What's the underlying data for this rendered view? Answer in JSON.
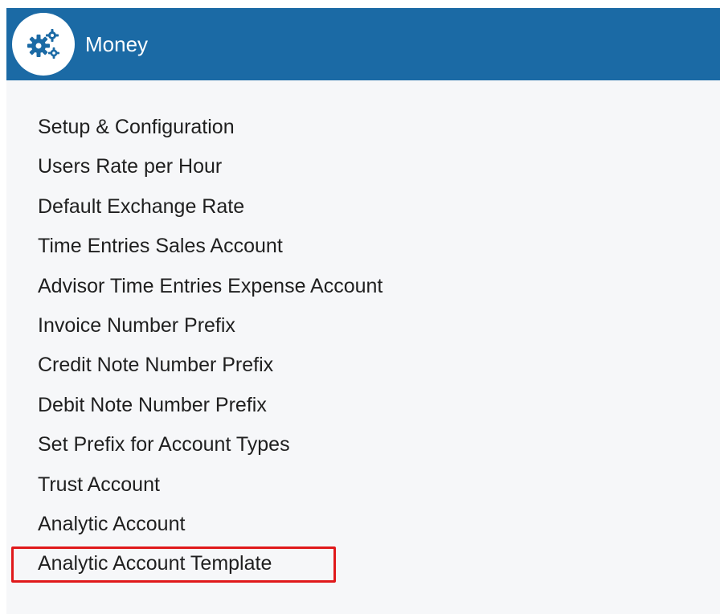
{
  "header": {
    "title": "Money",
    "icon": "gears-icon",
    "background_color": "#1b6aa5"
  },
  "menu": {
    "items": [
      {
        "label": "Setup & Configuration"
      },
      {
        "label": "Users Rate per Hour"
      },
      {
        "label": "Default Exchange Rate"
      },
      {
        "label": "Time Entries Sales Account"
      },
      {
        "label": "Advisor Time Entries Expense Account"
      },
      {
        "label": "Invoice Number Prefix"
      },
      {
        "label": "Credit Note Number Prefix"
      },
      {
        "label": "Debit Note Number Prefix"
      },
      {
        "label": "Set Prefix for Account Types"
      },
      {
        "label": "Trust Account"
      },
      {
        "label": "Analytic Account"
      },
      {
        "label": "Analytic Account Template",
        "highlighted": true
      }
    ],
    "highlight_color": "#e0191b"
  }
}
